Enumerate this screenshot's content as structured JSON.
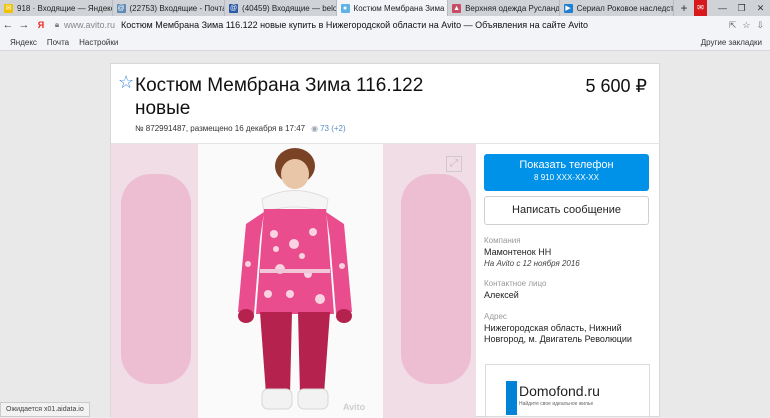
{
  "browser": {
    "tabs": [
      {
        "label": "918 · Входящие — Яндекс",
        "icon": "yandex-mail-icon",
        "active": false
      },
      {
        "label": "(22753) Входящие - Почта",
        "icon": "mail-icon",
        "active": false
      },
      {
        "label": "(40459) Входящие — belon",
        "icon": "mail-icon",
        "active": false
      },
      {
        "label": "Костюм Мембрана Зима",
        "icon": "avito-icon",
        "active": true
      },
      {
        "label": "Верхняя одежда Русланд",
        "icon": "shop-icon",
        "active": false
      },
      {
        "label": "Сериал Роковое наследст",
        "icon": "video-icon",
        "active": false
      }
    ],
    "new_tab": "+",
    "mail_badge": "✉",
    "window_buttons": [
      "—",
      "❐",
      "✕"
    ],
    "yandex_logo": "Я",
    "domain": "www.avito.ru",
    "page_title": "Костюм Мембрана Зима 116.122 новые купить в Нижегородской области на Avito — Объявления на сайте Avito",
    "bookmarks": [
      "Яндекс",
      "Почта",
      "Настройки"
    ],
    "other_bookmarks": "Другие закладки"
  },
  "listing": {
    "title": "Костюм Мембрана Зима 116.122 новые",
    "price": "5 600 ₽",
    "meta": "№ 872991487, размещено 16 декабря в 17:47",
    "views": "73 (+2)",
    "watermark": "Avito"
  },
  "sidebar": {
    "phone_button": "Показать телефон",
    "phone_masked": "8 910 XXX-XX-XX",
    "message_button": "Написать сообщение",
    "company_label": "Компания",
    "company_name": "Мамонтенок НН",
    "company_since": "На Avito с 12 ноября 2016",
    "contact_label": "Контактное лицо",
    "contact_name": "Алексей",
    "address_label": "Адрес",
    "address": "Нижегородская область, Нижний Новгород, м. Двигатель Революции"
  },
  "ad": {
    "brand": "Domofond.ru",
    "slogan": "Найдите свое идеальное жилье"
  },
  "status_bar": "Ожидается x01.aidata.io",
  "colors": {
    "accent": "#0091e8",
    "star": "#3b8ad8",
    "jacket": "#e94d8e",
    "pants": "#b5224e"
  }
}
